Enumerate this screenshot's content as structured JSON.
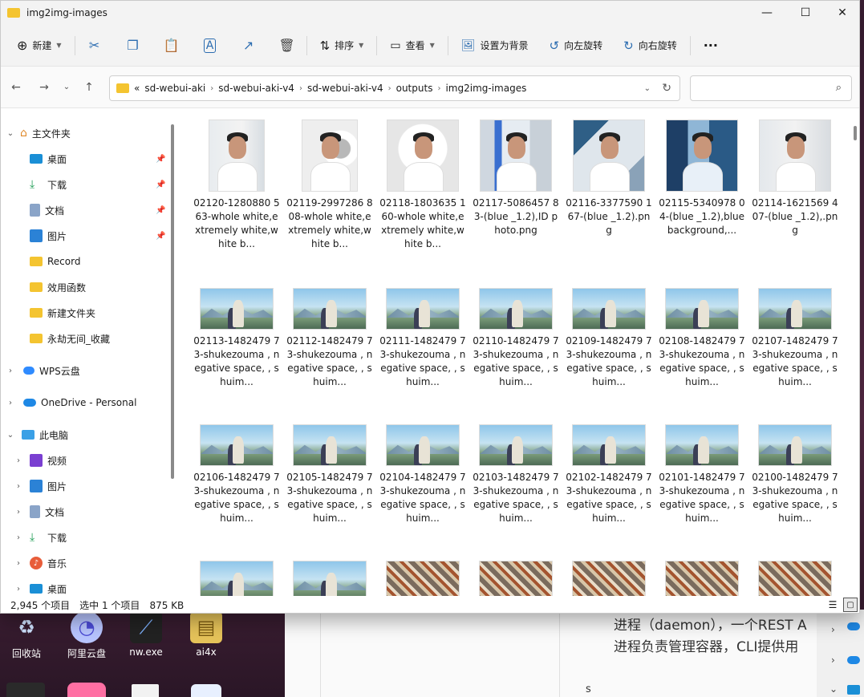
{
  "window": {
    "title": "img2img-images",
    "controls": {
      "minimize": "—",
      "maximize": "☐",
      "close": "✕"
    }
  },
  "toolbar": {
    "new_label": "新建",
    "sort_label": "排序",
    "view_label": "查看",
    "set_bg_label": "设置为背景",
    "rotate_left_label": "向左旋转",
    "rotate_right_label": "向右旋转",
    "more_label": "···"
  },
  "address": {
    "overflow": "«",
    "crumbs": [
      "sd-webui-aki",
      "sd-webui-aki-v4",
      "sd-webui-aki-v4",
      "outputs",
      "img2img-images"
    ],
    "search_placeholder": ""
  },
  "sidebar": {
    "home": "主文件夹",
    "quick": [
      {
        "label": "桌面",
        "icon": "desktop-icon",
        "pinned": true
      },
      {
        "label": "下载",
        "icon": "download-icon",
        "pinned": true
      },
      {
        "label": "文档",
        "icon": "document-icon",
        "pinned": true
      },
      {
        "label": "图片",
        "icon": "picture-icon",
        "pinned": true
      },
      {
        "label": "Record",
        "icon": "folder-icon",
        "pinned": false
      },
      {
        "label": "效用函数",
        "icon": "folder-icon",
        "pinned": false
      },
      {
        "label": "新建文件夹",
        "icon": "folder-icon",
        "pinned": false
      },
      {
        "label": "永劫无间_收藏",
        "icon": "folder-icon",
        "pinned": false
      }
    ],
    "wps": "WPS云盘",
    "onedrive": "OneDrive - Personal",
    "thispc": "此电脑",
    "pc_items": [
      {
        "label": "视频",
        "icon": "video-icon"
      },
      {
        "label": "图片",
        "icon": "picture-icon"
      },
      {
        "label": "文档",
        "icon": "document-icon"
      },
      {
        "label": "下载",
        "icon": "download-icon"
      },
      {
        "label": "音乐",
        "icon": "music-icon"
      },
      {
        "label": "桌面",
        "icon": "desktop-icon"
      }
    ]
  },
  "files": {
    "row1": [
      {
        "name": "02120-1280880 563-whole white,extremely white,white b...",
        "kind": "portrait"
      },
      {
        "name": "02119-2997286 808-whole white,extremely white,white b...",
        "kind": "portrait"
      },
      {
        "name": "02118-1803635 160-whole white,extremely white,white b...",
        "kind": "portrait"
      },
      {
        "name": "02117-5086457 83-(blue _1.2),ID photo.png",
        "kind": "portrait"
      },
      {
        "name": "02116-3377590 167-(blue _1.2).png",
        "kind": "portrait"
      },
      {
        "name": "02115-5340978 04-(blue _1.2),blue background,...",
        "kind": "portrait"
      },
      {
        "name": "02114-1621569 407-(blue _1.2),.png",
        "kind": "portrait"
      }
    ],
    "row2": [
      {
        "name": "02113-1482479 73-shukezouma , negative space, , shuim..."
      },
      {
        "name": "02112-1482479 73-shukezouma , negative space, , shuim..."
      },
      {
        "name": "02111-1482479 73-shukezouma , negative space, , shuim..."
      },
      {
        "name": "02110-1482479 73-shukezouma , negative space, , shuim..."
      },
      {
        "name": "02109-1482479 73-shukezouma , negative space, , shuim..."
      },
      {
        "name": "02108-1482479 73-shukezouma , negative space, , shuim..."
      },
      {
        "name": "02107-1482479 73-shukezouma , negative space, , shuim..."
      }
    ],
    "row3": [
      {
        "name": "02106-1482479 73-shukezouma , negative space, , shuim..."
      },
      {
        "name": "02105-1482479 73-shukezouma , negative space, , shuim..."
      },
      {
        "name": "02104-1482479 73-shukezouma , negative space, , shuim..."
      },
      {
        "name": "02103-1482479 73-shukezouma , negative space, , shuim..."
      },
      {
        "name": "02102-1482479 73-shukezouma , negative space, , shuim..."
      },
      {
        "name": "02101-1482479 73-shukezouma , negative space, , shuim..."
      },
      {
        "name": "02100-1482479 73-shukezouma , negative space, , shuim..."
      }
    ]
  },
  "status": {
    "count": "2,945 个项目",
    "selected": "选中 1 个项目",
    "size": "875 KB"
  },
  "desktop": {
    "icons": [
      {
        "label": "回收站"
      },
      {
        "label": "阿里云盘"
      },
      {
        "label": "nw.exe"
      },
      {
        "label": "ai4x"
      }
    ],
    "doc_line1": "进程（daemon），一个REST A",
    "doc_line2": "进程负责管理容器，CLI提供用",
    "doc_line3": "s"
  },
  "colors": {
    "accent": "#0067c0",
    "folder": "#f4c430"
  }
}
